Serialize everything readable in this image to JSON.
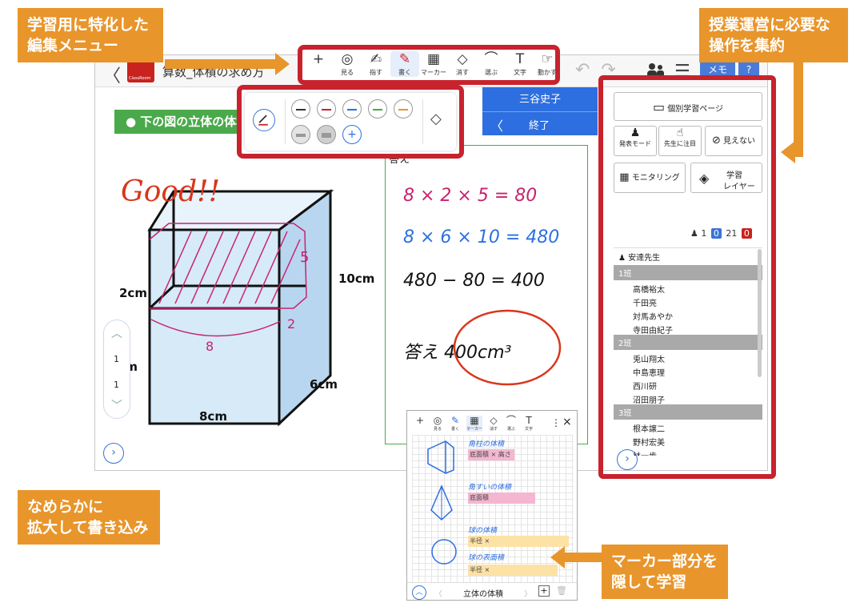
{
  "callouts": {
    "editing_menu": [
      "学習用に特化した",
      "編集メニュー"
    ],
    "class_ops": [
      "授業運営に必要な",
      "操作を集約"
    ],
    "zoom": [
      "なめらかに",
      "拡大して書き込み"
    ],
    "marker": [
      "マーカー部分を",
      "隠して学習"
    ]
  },
  "app": {
    "back": "〈",
    "logo_text": "ClassRoom",
    "title": "算数_体積の求め方",
    "memo": "メモ",
    "help": "?"
  },
  "toolbar": {
    "tools": [
      {
        "icon": "+",
        "label": ""
      },
      {
        "icon": "◎",
        "label": "見る"
      },
      {
        "icon": "✍",
        "label": "指す"
      },
      {
        "icon": "✎",
        "label": "書く"
      },
      {
        "icon": "▦",
        "label": "マーカー"
      },
      {
        "icon": "◇",
        "label": "消す"
      },
      {
        "icon": "⌒",
        "label": "選ぶ"
      },
      {
        "icon": "T",
        "label": "文字"
      },
      {
        "icon": "☞",
        "label": "動かす"
      }
    ]
  },
  "canvas": {
    "heading": "● 下の図の立体の体積",
    "answer_label": "答え",
    "student_name": "三谷史子",
    "end_label": "終了",
    "good": "Good!!",
    "dims": {
      "d10": "10cm",
      "d2": "2cm",
      "d6": "6cm",
      "d8": "8cm",
      "d5": "5cm"
    },
    "hw": {
      "five": "5",
      "two": "2",
      "eight": "8"
    },
    "eq1": "8 × 2 × 5 = 80",
    "eq2": "8 × 6 × 10 = 480",
    "eq3": "480 − 80 = 400",
    "answer": "答え 400cm³",
    "page": {
      "cur": "1",
      "total": "1"
    },
    "expand": "›"
  },
  "panel": {
    "individual": "個別学習ページ",
    "present": "発表モード",
    "focus": "先生に注目",
    "hide": "見えない",
    "monitor": "モニタリング",
    "layer1": "学習",
    "layer2": "レイヤー",
    "count_people": "1",
    "count_blue": "0",
    "count_total": "21",
    "count_red": "0",
    "teacher": "安達先生",
    "groups": [
      {
        "name": "1班",
        "students": [
          "高橋裕太",
          "千田亮",
          "対馬あやか",
          "寺田由紀子"
        ]
      },
      {
        "name": "2班",
        "students": [
          "兎山翔太",
          "中島恵理",
          "西川研",
          "沼田朋子"
        ]
      },
      {
        "name": "3班",
        "students": [
          "根本譲二",
          "野村宏美",
          "林一歩",
          ""
        ]
      }
    ]
  },
  "phone": {
    "tools": [
      {
        "icon": "+",
        "label": ""
      },
      {
        "icon": "◎",
        "label": "見る"
      },
      {
        "icon": "✎",
        "label": "書く"
      },
      {
        "icon": "▦",
        "label": "マーカー"
      },
      {
        "icon": "◇",
        "label": "消す"
      },
      {
        "icon": "⌒",
        "label": "選ぶ"
      },
      {
        "icon": "T",
        "label": "文字"
      }
    ],
    "more": "⋮",
    "close": "×",
    "n1": "角柱の体積",
    "m1": "底面積 × 高さ",
    "n2": "角すいの体積",
    "m2": "底面積",
    "n3": "球の体積",
    "m3": "半径 ×",
    "n4": "球の表面積",
    "m4": "半径 ×",
    "bottom_title": "立体の体積",
    "left_btn": "︿",
    "prev": "〈",
    "next": "〉",
    "add": "+",
    "trash": "🗑"
  },
  "colors": {
    "accent_red": "#c8232d",
    "callout_orange": "#e8952b",
    "blue": "#2d6fe0",
    "pink": "#c8236e",
    "green": "#4aa94a"
  }
}
